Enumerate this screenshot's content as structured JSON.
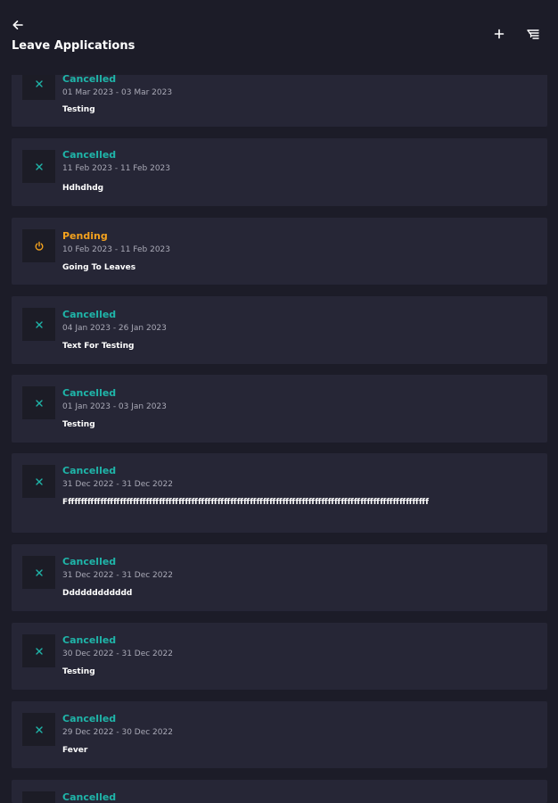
{
  "header": {
    "title": "Leave Applications",
    "back_icon": "arrow-left-icon",
    "add_icon": "plus-icon",
    "filter_icon": "filter-list-icon"
  },
  "colors": {
    "background": "#1c1c28",
    "card": "#262636",
    "cancelled": "#1fb5a9",
    "pending": "#f4a21e"
  },
  "applications": [
    {
      "status": "Cancelled",
      "dates": "01 Mar 2023 - 03 Mar 2023",
      "reason": "Testing"
    },
    {
      "status": "Cancelled",
      "dates": "11 Feb 2023 - 11 Feb 2023",
      "reason": "Hdhdhdg"
    },
    {
      "status": "Pending",
      "dates": "10 Feb 2023 - 11 Feb 2023",
      "reason": "Going To Leaves"
    },
    {
      "status": "Cancelled",
      "dates": "04 Jan 2023 - 26 Jan 2023",
      "reason": "Text For Testing"
    },
    {
      "status": "Cancelled",
      "dates": "01 Jan 2023 - 03 Jan 2023",
      "reason": "Testing"
    },
    {
      "status": "Cancelled",
      "dates": "31 Dec 2022 - 31 Dec 2022",
      "reason": "Ffffffffffffffffffffffffffffffffffffffffffffffffffffffffffffffffffffffffffffffffffffffffffffffffffffffffffffffff"
    },
    {
      "status": "Cancelled",
      "dates": "31 Dec 2022 - 31 Dec 2022",
      "reason": "Dddddddddddd"
    },
    {
      "status": "Cancelled",
      "dates": "30 Dec 2022 - 31 Dec 2022",
      "reason": "Testing"
    },
    {
      "status": "Cancelled",
      "dates": "29 Dec 2022 - 30 Dec 2022",
      "reason": "Fever"
    },
    {
      "status": "Cancelled",
      "dates": "",
      "reason": ""
    }
  ]
}
